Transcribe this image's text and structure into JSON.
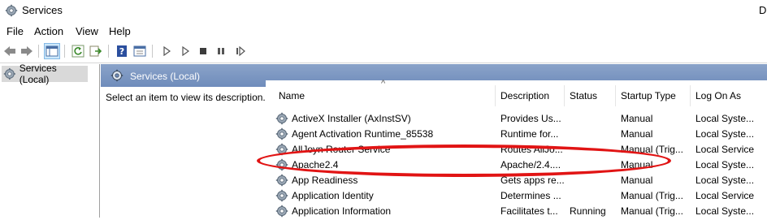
{
  "window": {
    "title": "Services",
    "title_suffix": "D"
  },
  "menu": [
    "File",
    "Action",
    "View",
    "Help"
  ],
  "toolbar": {
    "buttons": [
      "back-icon",
      "forward-icon",
      "console-tree-icon",
      "refresh-icon",
      "export-icon",
      "help-icon",
      "properties-icon",
      "play-icon",
      "play-alt-icon",
      "stop-icon",
      "pause-icon",
      "resume-icon"
    ]
  },
  "tree": {
    "root_label": "Services (Local)"
  },
  "pane": {
    "header": "Services (Local)",
    "description_hint": "Select an item to view its description."
  },
  "table": {
    "columns": [
      "Name",
      "Description",
      "Status",
      "Startup Type",
      "Log On As"
    ],
    "sort_indicator": "^",
    "rows": [
      {
        "name": "ActiveX Installer (AxInstSV)",
        "description": "Provides Us...",
        "status": "",
        "startup": "Manual",
        "logon": "Local Syste..."
      },
      {
        "name": "Agent Activation Runtime_85538",
        "description": "Runtime for...",
        "status": "",
        "startup": "Manual",
        "logon": "Local Syste..."
      },
      {
        "name": "AllJoyn Router Service",
        "description": "Routes AllJo...",
        "status": "",
        "startup": "Manual (Trig...",
        "logon": "Local Service"
      },
      {
        "name": "Apache2.4",
        "description": "Apache/2.4....",
        "status": "",
        "startup": "Manual",
        "logon": "Local Syste..."
      },
      {
        "name": "App Readiness",
        "description": "Gets apps re...",
        "status": "",
        "startup": "Manual",
        "logon": "Local Syste..."
      },
      {
        "name": "Application Identity",
        "description": "Determines ...",
        "status": "",
        "startup": "Manual (Trig...",
        "logon": "Local Service"
      },
      {
        "name": "Application Information",
        "description": "Facilitates t...",
        "status": "Running",
        "startup": "Manual (Trig...",
        "logon": "Local Syste..."
      }
    ]
  },
  "annotation": {
    "color": "#e11414",
    "target_row": "Apache2.4"
  }
}
